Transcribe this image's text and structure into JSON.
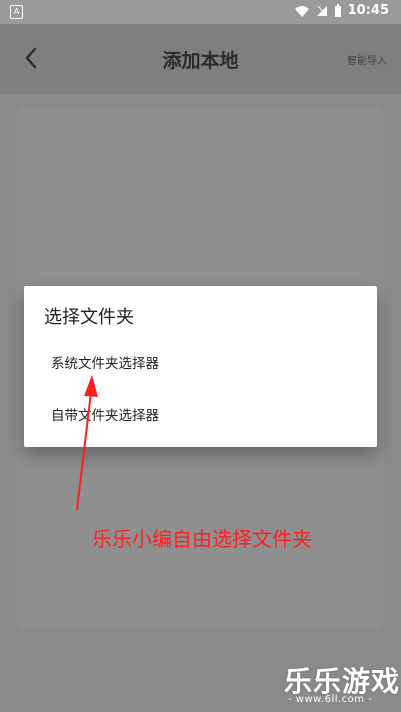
{
  "status_bar": {
    "time": "10:45",
    "left_badge": "A"
  },
  "header": {
    "title": "添加本地",
    "action_label": "智能导入"
  },
  "dialog": {
    "title": "选择文件夹",
    "options": [
      {
        "label": "系统文件夹选择器"
      },
      {
        "label": "自带文件夹选择器"
      }
    ]
  },
  "annotation": {
    "text": "乐乐小编自由选择文件夹",
    "color": "#ff1f1f"
  },
  "watermark": {
    "brand": "乐乐游戏",
    "site": "- www.6ll.com -"
  }
}
